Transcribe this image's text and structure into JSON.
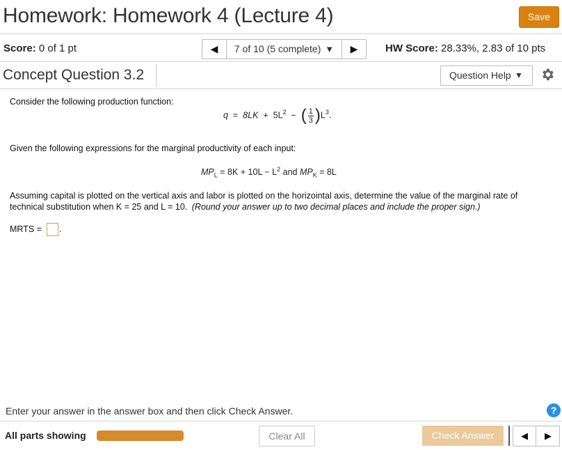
{
  "header": {
    "title": "Homework: Homework 4 (Lecture 4)",
    "save_label": "Save"
  },
  "score_row": {
    "score_label": "Score:",
    "score_value": "0 of 1 pt",
    "nav_label": "7 of 10 (5 complete)",
    "hw_label": "HW Score:",
    "hw_value": "28.33%, 2.83 of 10 pts"
  },
  "question": {
    "title": "Concept Question 3.2",
    "help_label": "Question Help",
    "intro": "Consider the following production function:",
    "eq1": {
      "lhs": "q",
      "eq": "=",
      "term1": "8LK",
      "plus": "+",
      "term2": "5L",
      "exp2": "2",
      "minus": "−",
      "frac_num": "1",
      "frac_den": "3",
      "term3": "L",
      "exp3": "3",
      "end": "."
    },
    "given": "Given the following expressions for the marginal productivity of each input:",
    "eq2": {
      "mpl": "MP",
      "mpl_sub": "L",
      "rhs": " = 8K + 10L − L",
      "exp": "2",
      "and": " and ",
      "mpk": "MP",
      "mpk_sub": "K",
      "mpk_rhs": " = 8L"
    },
    "assume_line1": "Assuming capital is plotted on the vertical axis and labor is plotted on the horizointal axis, determine the value of the marginal rate of",
    "assume_line2": "technical substitution when K = 25 and L = 10.",
    "assume_note": "(Round your answer up to two decimal places and include the proper sign.)",
    "mrts_label": "MRTS =",
    "mrts_value": "",
    "mrts_end": "."
  },
  "footer": {
    "instruction": "Enter your answer in the answer box and then click Check Answer.",
    "help_icon": "?",
    "parts_label": "All parts showing",
    "progress_fraction": 1.0,
    "clear_label": "Clear All",
    "check_label": "Check Answer"
  },
  "icons": {
    "prev": "◀",
    "next": "▶",
    "caret": "▼"
  },
  "colors": {
    "accent": "#d9820f",
    "progress": "#d58a2b",
    "check_disabled": "#ecc99a",
    "help": "#2d8fe0",
    "answer_box_border": "#c9a33a"
  }
}
